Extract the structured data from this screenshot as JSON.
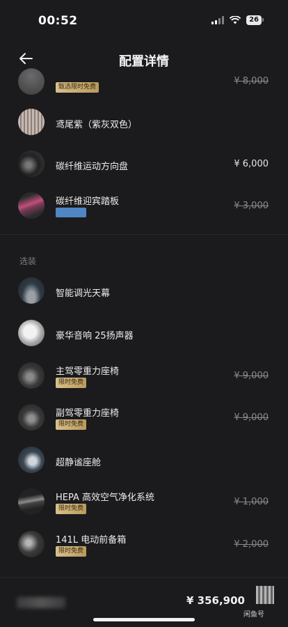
{
  "status": {
    "time": "00:52",
    "battery": "26"
  },
  "nav": {
    "title": "配置详情"
  },
  "items_top": [
    {
      "name": "",
      "price": "¥ 8,000",
      "strike": true,
      "tag": "甄选限时免费"
    },
    {
      "name": "鸢尾紫（紫灰双色）",
      "price": "",
      "strike": false
    },
    {
      "name": "碳纤维运动方向盘",
      "price": "¥ 6,000",
      "strike": false
    },
    {
      "name": "碳纤维迎宾踏板",
      "price": "¥ 3,000",
      "strike": true
    }
  ],
  "section": {
    "label": "选装"
  },
  "items_optional": [
    {
      "name": "智能调光天幕",
      "price": ""
    },
    {
      "name": "豪华音响 25扬声器",
      "price": ""
    },
    {
      "name": "主驾零重力座椅",
      "price": "¥ 9,000",
      "strike": true,
      "tag": "限时免费"
    },
    {
      "name": "副驾零重力座椅",
      "price": "¥ 9,000",
      "strike": true,
      "tag": "限时免费"
    },
    {
      "name": "超静谧座舱",
      "price": ""
    },
    {
      "name": "HEPA 高效空气净化系统",
      "price": "¥ 1,000",
      "strike": true,
      "tag": "限时免费"
    },
    {
      "name": "141L 电动前备箱",
      "price": "¥ 2,000",
      "strike": true,
      "tag": "限时免费"
    }
  ],
  "bottom": {
    "total": "¥ 356,900",
    "watermark": "闲鱼号"
  },
  "colors": {
    "background": "#1b1b1d",
    "tag_gold": "#d9c08b",
    "swatch_blue": "#4f86c4"
  },
  "icons": {
    "back": "arrow-left-icon"
  }
}
